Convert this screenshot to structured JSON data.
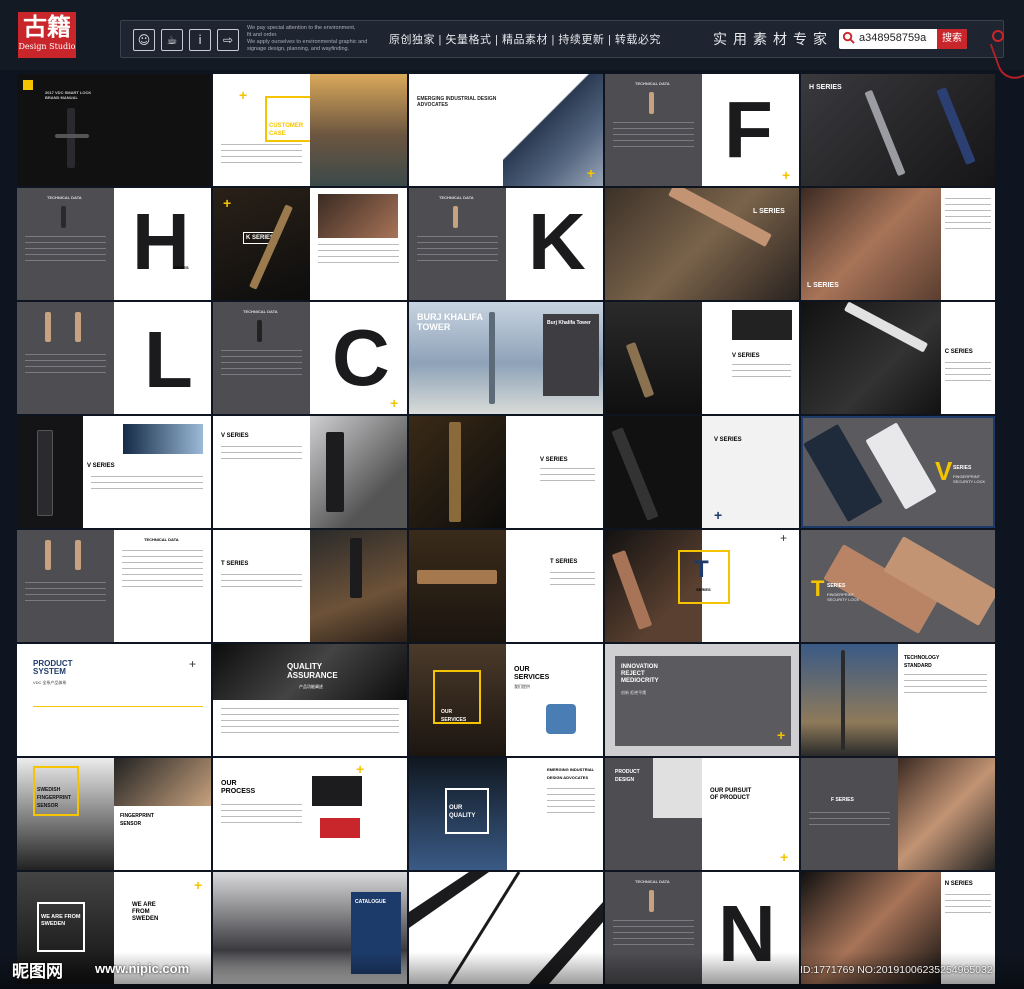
{
  "header": {
    "logo_cn": "古籍",
    "logo_en": "Design Studio",
    "icons": [
      "person-icon",
      "cup-icon",
      "info-icon",
      "exit-icon"
    ],
    "note_lines": [
      "We pay special attention to the environment,",
      "fit and order.",
      "We apply ourselves to environmental graphic and",
      "signage design, planning, and wayfinding."
    ],
    "slogan": "原创独家 | 矢量格式 | 精品素材 | 持续更新 | 转载必究",
    "expert": "实用素材专家",
    "search_value": "a348958759a",
    "search_button": "搜索"
  },
  "pages": {
    "r1": {
      "brand": "2017 VDC SMART LOCK BRAND MANUAL",
      "customer_case": "CUSTOMER CASE",
      "customer_case_cn": "客户案例",
      "emerging": "EMERGING INDUSTRIAL DESIGN ADVOCATES",
      "tech": "TECHNICAL DATA",
      "letter_f": "F",
      "h_series": "H SERIES"
    },
    "r2": {
      "tech": "TECHNICAL DATA",
      "letter_h": "H",
      "h_series_label": "SERIES",
      "k_series": "K SERIES",
      "letter_k": "K",
      "l_series": "L SERIES",
      "l_series2": "L SERIES"
    },
    "r3": {
      "letter_l": "L",
      "tech": "TECHNICAL DATA",
      "letter_c": "C",
      "burj": "BURJ KHALIFA TOWER",
      "burj_small": "Burj Khalifa Tower",
      "v_series": "V SERIES",
      "c_series": "C SERIES"
    },
    "r4": {
      "v_series": "V SERIES",
      "v_series2": "V SERIES",
      "v_series3": "V SERIES",
      "v_series4": "V SERIES",
      "v_big": "V",
      "v_big_label": "SERIES",
      "v_big_sub": "FINGERPRINT SECURITY LOCK"
    },
    "r5": {
      "tech": "TECHNICAL DATA",
      "t_series": "T SERIES",
      "t_series2": "T SERIES",
      "t_big": "T",
      "t_big_label": "SERIES",
      "t_big2": "T",
      "t_big2_label": "SERIES",
      "t_big2_sub": "FINGERPRINT SECURITY LOCK"
    },
    "r6": {
      "product_system": "PRODUCT SYSTEM",
      "product_system_sub": "VDC 全系产品体系",
      "quality": "QUALITY ASSURANCE",
      "quality_cn": "产品功能阐述",
      "our_services": "OUR SERVICES",
      "our_services_cn": "我们提供",
      "services_box": "OUR SERVICES",
      "innovation": "INNOVATION REJECT MEDIOCRITY",
      "innovation_cn": "创新 拒绝平庸",
      "tech_standard": "TECHNOLOGY STANDARD"
    },
    "r7": {
      "swedish": "SWEDISH FINGERPRINT SENSOR",
      "fingerprint": "FINGERPRINT SENSOR",
      "our_process": "OUR PROCESS",
      "our_quality": "OUR QUALITY",
      "emerging": "EMERGING INDUSTRIAL DESIGN ADVOCATES",
      "product_design": "PRODUCT DESIGN",
      "pursuit": "OUR PURSUIT OF PRODUCT",
      "f_series": "F SERIES"
    },
    "r8": {
      "we_are": "WE ARE FROM SWEDEN",
      "we_are2": "WE ARE FROM SWEDEN",
      "catalogue": "CATALOGUE",
      "tech": "TECHNICAL DATA",
      "letter_n": "N",
      "n_series": "N SERIES"
    }
  },
  "watermark": {
    "site": "昵图网",
    "url": "www.nipic.com",
    "id": "ID:1771769 NO:20191006235254965032"
  },
  "colors": {
    "accent_yellow": "#f5c400",
    "brand_red": "#c8262b",
    "navy": "#1d3b6a",
    "bronze": "#b98466"
  }
}
